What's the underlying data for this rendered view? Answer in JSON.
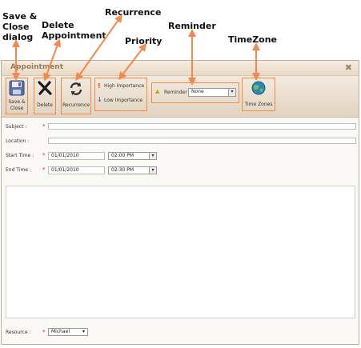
{
  "callouts": {
    "save_close": "Save &\nClose\ndialog",
    "delete": "Delete\nAppointment",
    "recurrence": "Recurrence",
    "priority": "Priority",
    "reminder": "Reminder",
    "timezone": "TimeZone"
  },
  "dialog": {
    "title": "Appointment",
    "close_glyph": "✖"
  },
  "toolbar": {
    "save_close_label": "Save &\nClose",
    "delete_label": "Delete",
    "recurrence_label": "Recurrence",
    "high_importance": "High Importance",
    "low_importance": "Low Importance",
    "reminder_label": "Reminder",
    "reminder_value": "None",
    "timezones_label": "Time Zones"
  },
  "form": {
    "subject_label": "Subject :",
    "subject_value": "",
    "location_label": "Location :",
    "location_value": "",
    "start_label": "Start Time :",
    "start_date": "01/01/2010",
    "start_time": "02:00 PM",
    "end_label": "End Time :",
    "end_date": "01/01/2010",
    "end_time": "02:30 PM",
    "required_mark": "*",
    "resource_label": "Resource :",
    "resource_value": "Michael"
  },
  "colors": {
    "highlight": "#f08a4b",
    "arrow": "#f5894d"
  }
}
